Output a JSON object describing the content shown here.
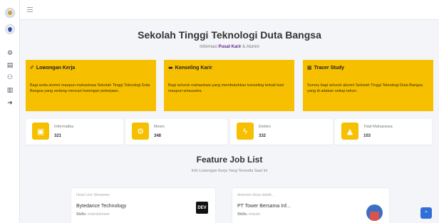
{
  "sidebar": {
    "icons": [
      {
        "name": "dashboard-icon",
        "glyph": "⚙"
      },
      {
        "name": "document-icon",
        "glyph": "▤"
      },
      {
        "name": "users-icon",
        "glyph": "⚇"
      },
      {
        "name": "building-icon",
        "glyph": "▥"
      },
      {
        "name": "logout-icon",
        "glyph": "➜"
      }
    ]
  },
  "header": {
    "title": "Sekolah Tinggi Teknologi Duta Bangsa",
    "subtitle_prefix": "Informasi",
    "subtitle_strong": "Pusat Karir",
    "subtitle_suffix": "& Alumni"
  },
  "info_cards": [
    {
      "icon": "✐",
      "title": "Lowongan Kerja",
      "body": "Bagi anda alumni maupun mahasiswa Sekolah Tinggi Teknologi Duta Bangsa yang sedang mencari lowongan pekerjaan."
    },
    {
      "icon": "▬",
      "title": "Konseling Karir",
      "body": "Bagi seluruh mahasiswa yang membutuhkan konseling terkait karir maupun wirausaha."
    },
    {
      "icon": "▦",
      "title": "Tracer Study",
      "body": "Survey bagi seluruh alumni Sekolah Tinggi Teknologi Duta Bangsa yang di adakan setiap tahun."
    }
  ],
  "stats": [
    {
      "icon": "▣",
      "label": "Informatika",
      "value": "321"
    },
    {
      "icon": "⚙",
      "label": "Mesin",
      "value": "348"
    },
    {
      "icon": "ϟ",
      "label": "Elektro",
      "value": "332"
    },
    {
      "icon": "▲",
      "label": "Total Mahasiswa",
      "value": "103"
    }
  ],
  "feature": {
    "title": "Feature Job List",
    "subtitle": "Info Lowongan Kerja Yang Tersedia Saat Ini"
  },
  "jobs": [
    {
      "position": "Host Live Streamer",
      "company": "Bytedance Technology",
      "skill_label": "Skills:",
      "skill": "entertainment",
      "logo_text": "DEV"
    },
    {
      "position": "dolorem dicta debiti...",
      "company": "PT Tower Bersama Inf...",
      "skill_label": "Skills:",
      "skill": "industri",
      "logo_text": ""
    }
  ],
  "colors": {
    "accent": "#f6c000",
    "brand_purple": "#5b2c83",
    "scroll_button": "#2f6fd6"
  }
}
